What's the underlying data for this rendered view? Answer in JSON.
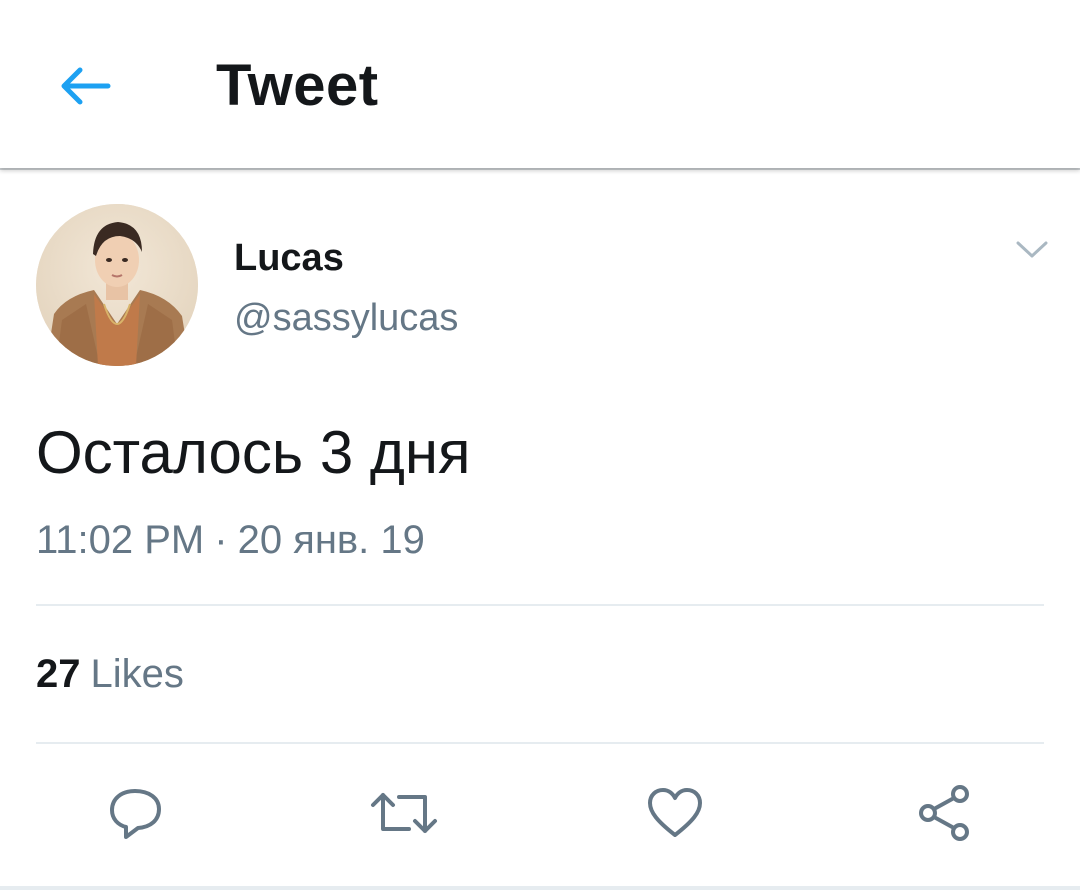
{
  "header": {
    "title": "Tweet",
    "back_icon": "arrow-left-icon"
  },
  "tweet": {
    "author": {
      "name": "Lucas",
      "handle": "@sassylucas"
    },
    "text": "Осталось 3 дня",
    "time": "11:02 PM",
    "separator": "·",
    "date": "20 янв. 19",
    "likes_count": "27",
    "likes_label": "Likes"
  },
  "actions": [
    {
      "name": "reply",
      "icon": "reply-icon"
    },
    {
      "name": "retweet",
      "icon": "retweet-icon"
    },
    {
      "name": "like",
      "icon": "heart-icon"
    },
    {
      "name": "share",
      "icon": "share-icon"
    }
  ],
  "colors": {
    "accent": "#1da1f2",
    "text_primary": "#14171a",
    "text_secondary": "#657786",
    "icon_gray": "#657786",
    "divider": "#e6ecf0"
  }
}
